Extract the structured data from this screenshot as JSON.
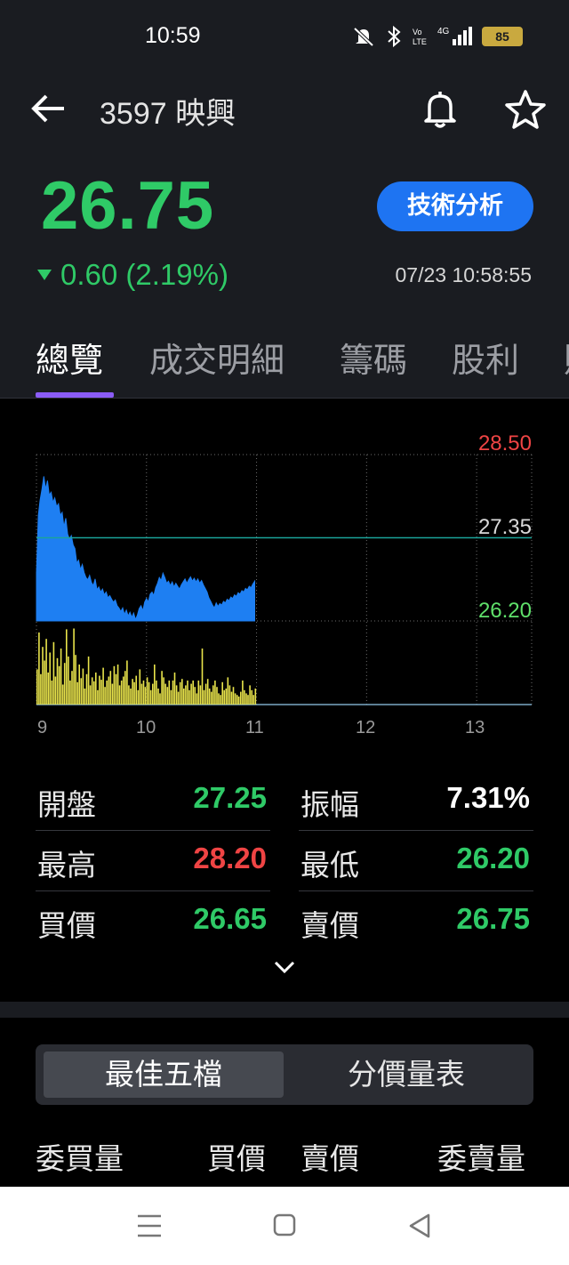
{
  "status": {
    "time": "10:59",
    "battery": "85"
  },
  "header": {
    "title": "3597 映興"
  },
  "quote": {
    "price": "26.75",
    "change": "0.60 (2.19%)",
    "time": "07/23 10:58:55",
    "tech_button": "技術分析",
    "price_color": "#2fca67"
  },
  "tabs": [
    "總覽",
    "成交明細",
    "籌碼",
    "股利",
    "財"
  ],
  "chart_data": {
    "type": "area",
    "y_labels": {
      "high": "28.50",
      "ref": "27.35",
      "low": "26.20"
    },
    "ylim": [
      26.2,
      28.5
    ],
    "reference": 27.35,
    "x_ticks": [
      "9",
      "10",
      "11",
      "12",
      "13"
    ],
    "x_range": [
      0,
      270
    ],
    "price_series": [
      {
        "t": 0,
        "v": 26.86
      },
      {
        "t": 1,
        "v": 27.66
      },
      {
        "t": 2,
        "v": 27.87
      },
      {
        "t": 3,
        "v": 28.02
      },
      {
        "t": 4,
        "v": 28.2
      },
      {
        "t": 5,
        "v": 28.02
      },
      {
        "t": 6,
        "v": 28.14
      },
      {
        "t": 7,
        "v": 27.94
      },
      {
        "t": 8,
        "v": 27.98
      },
      {
        "t": 9,
        "v": 27.84
      },
      {
        "t": 10,
        "v": 27.9
      },
      {
        "t": 11,
        "v": 27.78
      },
      {
        "t": 12,
        "v": 27.82
      },
      {
        "t": 13,
        "v": 27.66
      },
      {
        "t": 14,
        "v": 27.7
      },
      {
        "t": 15,
        "v": 27.5
      },
      {
        "t": 16,
        "v": 27.62
      },
      {
        "t": 17,
        "v": 27.4
      },
      {
        "t": 18,
        "v": 27.33
      },
      {
        "t": 19,
        "v": 27.38
      },
      {
        "t": 20,
        "v": 27.25
      },
      {
        "t": 21,
        "v": 27.2
      },
      {
        "t": 22,
        "v": 27.0
      },
      {
        "t": 23,
        "v": 27.04
      },
      {
        "t": 24,
        "v": 26.91
      },
      {
        "t": 25,
        "v": 26.98
      },
      {
        "t": 26,
        "v": 26.87
      },
      {
        "t": 27,
        "v": 26.8
      },
      {
        "t": 28,
        "v": 26.77
      },
      {
        "t": 29,
        "v": 26.83
      },
      {
        "t": 30,
        "v": 26.73
      },
      {
        "t": 31,
        "v": 26.69
      },
      {
        "t": 32,
        "v": 26.78
      },
      {
        "t": 33,
        "v": 26.63
      },
      {
        "t": 34,
        "v": 26.67
      },
      {
        "t": 35,
        "v": 26.6
      },
      {
        "t": 36,
        "v": 26.64
      },
      {
        "t": 37,
        "v": 26.56
      },
      {
        "t": 38,
        "v": 26.6
      },
      {
        "t": 39,
        "v": 26.52
      },
      {
        "t": 40,
        "v": 26.55
      },
      {
        "t": 41,
        "v": 26.5
      },
      {
        "t": 42,
        "v": 26.46
      },
      {
        "t": 43,
        "v": 26.49
      },
      {
        "t": 44,
        "v": 26.41
      },
      {
        "t": 45,
        "v": 26.38
      },
      {
        "t": 46,
        "v": 26.33
      },
      {
        "t": 47,
        "v": 26.38
      },
      {
        "t": 48,
        "v": 26.29
      },
      {
        "t": 49,
        "v": 26.35
      },
      {
        "t": 50,
        "v": 26.27
      },
      {
        "t": 51,
        "v": 26.32
      },
      {
        "t": 52,
        "v": 26.25
      },
      {
        "t": 53,
        "v": 26.31
      },
      {
        "t": 54,
        "v": 26.22
      },
      {
        "t": 55,
        "v": 26.28
      },
      {
        "t": 56,
        "v": 26.37
      },
      {
        "t": 57,
        "v": 26.41
      },
      {
        "t": 58,
        "v": 26.34
      },
      {
        "t": 59,
        "v": 26.46
      },
      {
        "t": 60,
        "v": 26.51
      },
      {
        "t": 61,
        "v": 26.46
      },
      {
        "t": 62,
        "v": 26.57
      },
      {
        "t": 63,
        "v": 26.6
      },
      {
        "t": 64,
        "v": 26.55
      },
      {
        "t": 65,
        "v": 26.66
      },
      {
        "t": 66,
        "v": 26.72
      },
      {
        "t": 67,
        "v": 26.8
      },
      {
        "t": 68,
        "v": 26.76
      },
      {
        "t": 69,
        "v": 26.86
      },
      {
        "t": 70,
        "v": 26.8
      },
      {
        "t": 71,
        "v": 26.72
      },
      {
        "t": 72,
        "v": 26.75
      },
      {
        "t": 73,
        "v": 26.69
      },
      {
        "t": 74,
        "v": 26.74
      },
      {
        "t": 75,
        "v": 26.67
      },
      {
        "t": 76,
        "v": 26.72
      },
      {
        "t": 77,
        "v": 26.68
      },
      {
        "t": 78,
        "v": 26.64
      },
      {
        "t": 79,
        "v": 26.7
      },
      {
        "t": 80,
        "v": 26.74
      },
      {
        "t": 81,
        "v": 26.78
      },
      {
        "t": 82,
        "v": 26.72
      },
      {
        "t": 83,
        "v": 26.77
      },
      {
        "t": 84,
        "v": 26.81
      },
      {
        "t": 85,
        "v": 26.75
      },
      {
        "t": 86,
        "v": 26.79
      },
      {
        "t": 87,
        "v": 26.74
      },
      {
        "t": 88,
        "v": 26.78
      },
      {
        "t": 89,
        "v": 26.72
      },
      {
        "t": 90,
        "v": 26.76
      },
      {
        "t": 91,
        "v": 26.7
      },
      {
        "t": 92,
        "v": 26.65
      },
      {
        "t": 93,
        "v": 26.6
      },
      {
        "t": 94,
        "v": 26.52
      },
      {
        "t": 95,
        "v": 26.47
      },
      {
        "t": 96,
        "v": 26.42
      },
      {
        "t": 97,
        "v": 26.38
      },
      {
        "t": 98,
        "v": 26.45
      },
      {
        "t": 99,
        "v": 26.4
      },
      {
        "t": 100,
        "v": 26.44
      },
      {
        "t": 101,
        "v": 26.42
      },
      {
        "t": 102,
        "v": 26.47
      },
      {
        "t": 103,
        "v": 26.45
      },
      {
        "t": 104,
        "v": 26.5
      },
      {
        "t": 105,
        "v": 26.48
      },
      {
        "t": 106,
        "v": 26.53
      },
      {
        "t": 107,
        "v": 26.51
      },
      {
        "t": 108,
        "v": 26.56
      },
      {
        "t": 109,
        "v": 26.54
      },
      {
        "t": 110,
        "v": 26.59
      },
      {
        "t": 111,
        "v": 26.57
      },
      {
        "t": 112,
        "v": 26.62
      },
      {
        "t": 113,
        "v": 26.6
      },
      {
        "t": 114,
        "v": 26.65
      },
      {
        "t": 115,
        "v": 26.63
      },
      {
        "t": 116,
        "v": 26.68
      },
      {
        "t": 117,
        "v": 26.66
      },
      {
        "t": 118,
        "v": 26.71
      },
      {
        "t": 119,
        "v": 26.75
      }
    ],
    "volume_max": 100,
    "volumes": [
      44,
      90,
      38,
      72,
      55,
      82,
      40,
      65,
      30,
      78,
      35,
      58,
      48,
      70,
      25,
      52,
      94,
      60,
      30,
      42,
      95,
      62,
      28,
      50,
      33,
      45,
      20,
      38,
      60,
      24,
      34,
      29,
      40,
      18,
      36,
      31,
      46,
      22,
      30,
      35,
      42,
      26,
      48,
      38,
      50,
      24,
      30,
      35,
      42,
      55,
      24,
      20,
      32,
      28,
      36,
      18,
      44,
      26,
      30,
      22,
      34,
      28,
      18,
      26,
      50,
      30,
      20,
      14,
      42,
      34,
      26,
      22,
      30,
      18,
      30,
      40,
      24,
      16,
      28,
      32,
      20,
      24,
      30,
      18,
      26,
      30,
      22,
      14,
      30,
      24,
      70,
      18,
      26,
      32,
      20,
      16,
      24,
      30,
      22,
      14,
      12,
      28,
      18,
      20,
      34,
      24,
      16,
      22,
      14,
      12,
      10,
      16,
      30,
      18,
      14,
      12,
      24,
      18,
      12,
      20
    ]
  },
  "stats": {
    "open_label": "開盤",
    "open": "27.25",
    "amp_label": "振幅",
    "amp": "7.31%",
    "high_label": "最高",
    "high": "28.20",
    "low_label": "最低",
    "low": "26.20",
    "bid_label": "買價",
    "bid": "26.65",
    "ask_label": "賣價",
    "ask": "26.75"
  },
  "segment": {
    "best_five": "最佳五檔",
    "price_volume": "分價量表"
  },
  "order_book": {
    "bid_vol": "委買量",
    "bid_price": "買價",
    "ask_price": "賣價",
    "ask_vol": "委賣量"
  },
  "colors": {
    "up": "#ef4444",
    "down": "#2fca67",
    "area": "#1e7ff2",
    "volume": "#e9e44b",
    "accent": "#1e74f2",
    "tab_indicator": "#8b5cf6"
  }
}
